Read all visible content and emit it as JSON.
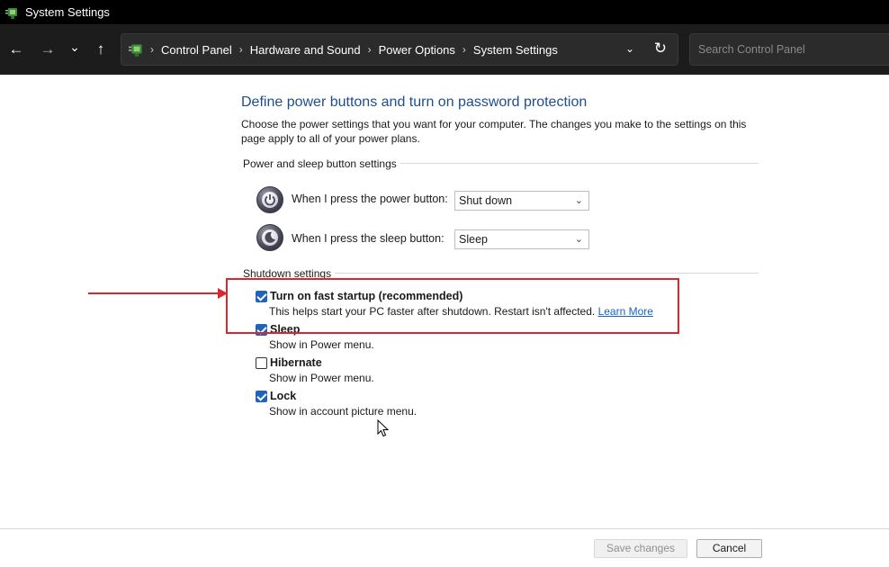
{
  "window": {
    "title": "System Settings",
    "icon": "control-panel-icon"
  },
  "nav": {
    "back": "←",
    "forward": "→",
    "recent": "⌄",
    "up": "↑",
    "breadcrumbs": [
      "Control Panel",
      "Hardware and Sound",
      "Power Options",
      "System Settings"
    ],
    "crumb_separator": "›",
    "dropdown": "⌄",
    "refresh": "↻",
    "search_placeholder": "Search Control Panel"
  },
  "main": {
    "title": "Define power buttons and turn on password protection",
    "description": "Choose the power settings that you want for your computer. The changes you make to the settings on this page apply to all of your power plans.",
    "power_group": {
      "title": "Power and sleep button settings",
      "rows": [
        {
          "label": "When I press the power button:",
          "value": "Shut down",
          "icon": "power-button-icon"
        },
        {
          "label": "When I press the sleep button:",
          "value": "Sleep",
          "icon": "sleep-button-icon"
        }
      ]
    },
    "shutdown_group": {
      "title": "Shutdown settings",
      "options": [
        {
          "title": "Turn on fast startup (recommended)",
          "desc": "This helps start your PC faster after shutdown. Restart isn't affected.",
          "link": "Learn More",
          "checked": true
        },
        {
          "title": "Sleep",
          "desc": "Show in Power menu.",
          "checked": true
        },
        {
          "title": "Hibernate",
          "desc": "Show in Power menu.",
          "checked": false
        },
        {
          "title": "Lock",
          "desc": "Show in account picture menu.",
          "checked": true
        }
      ]
    }
  },
  "footer": {
    "save_label": "Save changes",
    "cancel_label": "Cancel"
  },
  "colors": {
    "accent": "#1f63bb",
    "title_blue": "#1e4e8c",
    "annotation_red": "#d8282d",
    "link": "#1a62c4"
  }
}
